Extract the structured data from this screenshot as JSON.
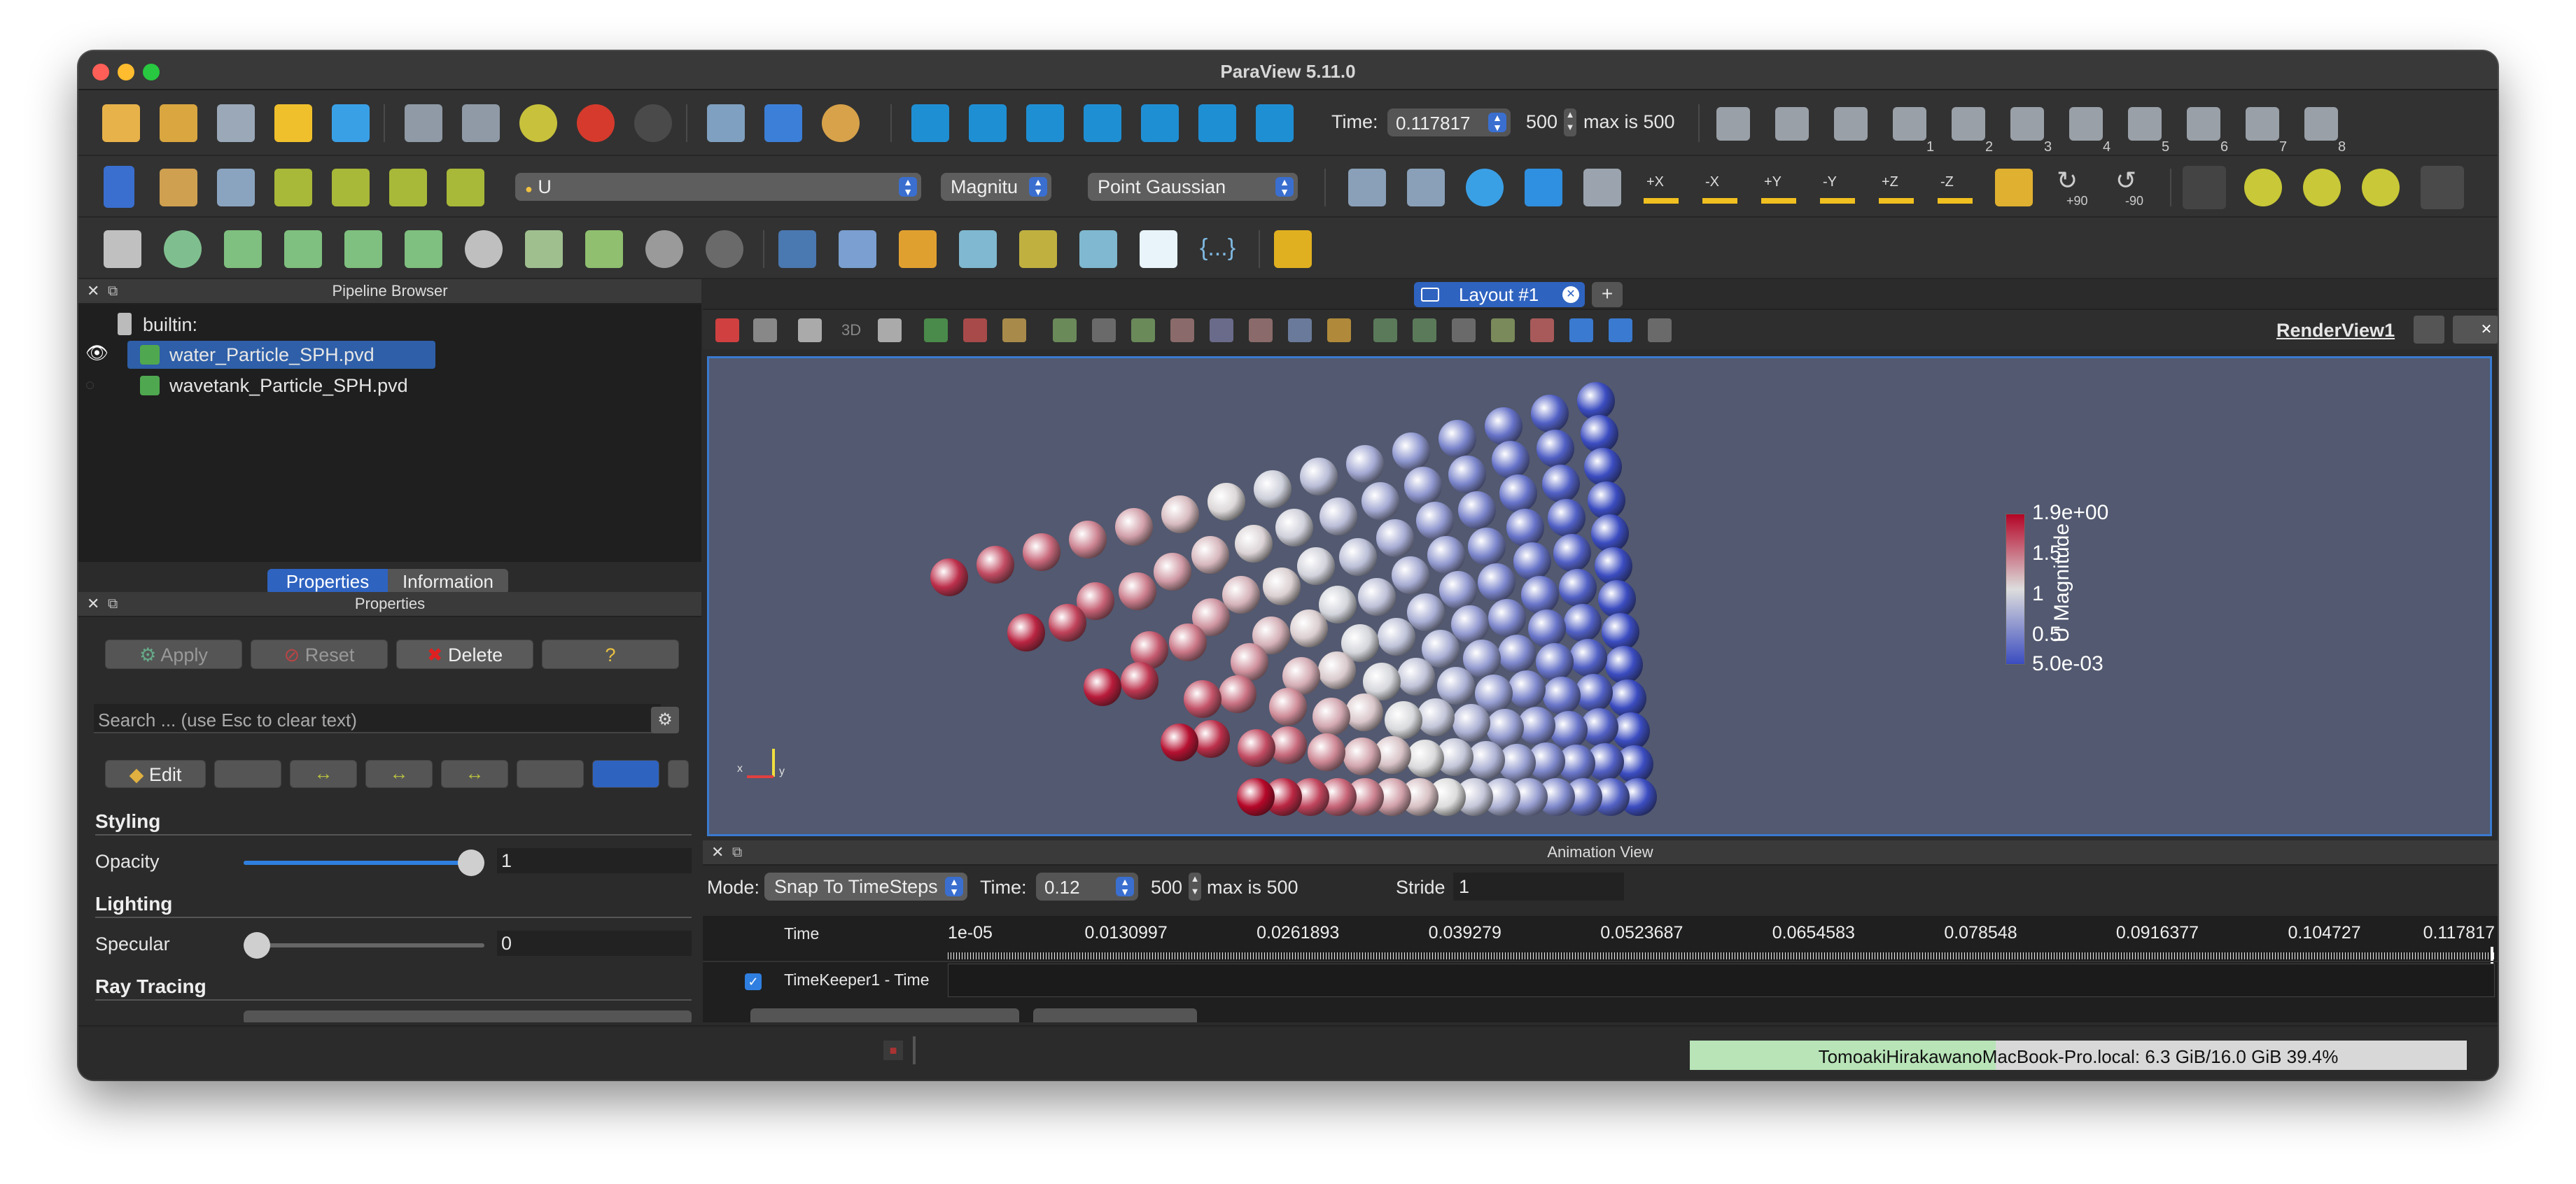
{
  "window": {
    "title": "ParaView 5.11.0"
  },
  "toolbar_time": {
    "label": "Time:",
    "value": "0.117817",
    "step": "500",
    "max": "max is 500"
  },
  "toolbar_color": {
    "array": "U",
    "component": "Magnitu",
    "representation": "Point Gaussian"
  },
  "camera_icons": {
    "plus_x": "+X",
    "minus_x": "-X",
    "plus_y": "+Y",
    "minus_y": "-Y",
    "plus_z": "+Z",
    "minus_z": "-Z",
    "rot_plus": "+90",
    "rot_minus": "-90"
  },
  "snapshot_numbers": [
    "1",
    "2",
    "3",
    "4",
    "5",
    "6",
    "7",
    "8"
  ],
  "filters_toolbar": {
    "braces": "{...}"
  },
  "pipeline": {
    "title": "Pipeline Browser",
    "items": [
      {
        "label": "builtin:"
      },
      {
        "label": "water_Particle_SPH.pvd",
        "selected": true,
        "visible": true
      },
      {
        "label": "wavetank_Particle_SPH.pvd",
        "selected": false,
        "visible": false
      }
    ]
  },
  "props_tabs": {
    "properties": "Properties",
    "information": "Information"
  },
  "properties": {
    "title": "Properties",
    "apply": "Apply",
    "reset": "Reset",
    "delete": "Delete",
    "help": "?",
    "search_placeholder": "Search ... (use Esc to clear text)",
    "edit": "Edit",
    "styling": "Styling",
    "opacity_label": "Opacity",
    "opacity_value": "1",
    "opacity_level": 1.0,
    "lighting": "Lighting",
    "specular_label": "Specular",
    "specular_value": "0",
    "specular_level": 0.0,
    "ray_tracing": "Ray Tracing"
  },
  "layout": {
    "tab": "Layout #1",
    "add": "+",
    "view_name": "RenderView1",
    "btn_3d": "3D"
  },
  "colorbar": {
    "title": "U Magnitude",
    "ticks": [
      "1.9e+00",
      "1.5",
      "1",
      "0.5",
      "5.0e-03"
    ],
    "min": 0.005,
    "max": 1.9,
    "colors": [
      "#b40426",
      "#dddddd",
      "#3b4cc0"
    ]
  },
  "axes": {
    "x": "x",
    "y": "y"
  },
  "animation": {
    "title": "Animation View",
    "mode_label": "Mode:",
    "mode": "Snap To TimeSteps",
    "time_label": "Time:",
    "time": "0.12",
    "step": "500",
    "max": "max is 500",
    "stride_label": "Stride",
    "stride": "1",
    "time_header": "Time",
    "timeline_ticks": [
      "1e-05",
      "0.0130997",
      "0.0261893",
      "0.039279",
      "0.0523687",
      "0.0654583",
      "0.078548",
      "0.0916377",
      "0.104727",
      "0.117817"
    ],
    "track": "TimeKeeper1 - Time",
    "track_checked": true
  },
  "statusbar": {
    "memory": "TomoakiHirakawanoMacBook-Pro.local: 6.3 GiB/16.0 GiB 39.4%",
    "memory_fraction": 0.394
  }
}
